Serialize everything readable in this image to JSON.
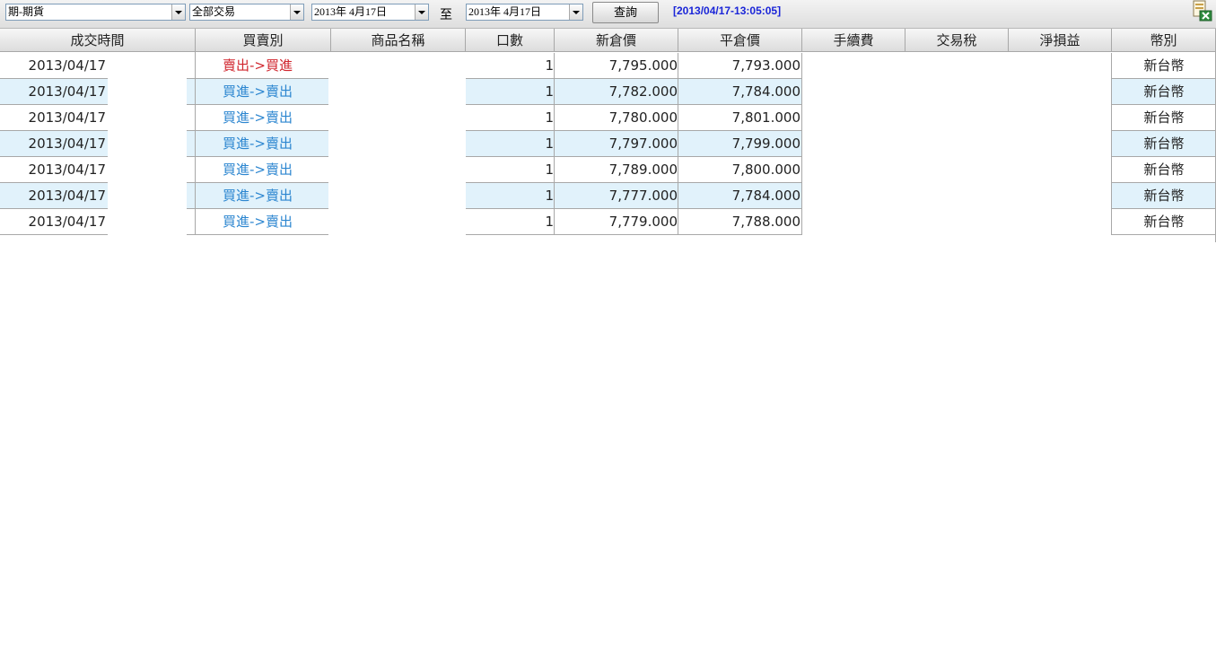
{
  "toolbar": {
    "account_select": "期-期貨",
    "trade_type_select": "全部交易",
    "date_from": "2013年  4月17日",
    "to_label": "至",
    "date_to": "2013年  4月17日",
    "query_label": "查詢",
    "timestamp": "[2013/04/17-13:05:05]"
  },
  "columns": [
    "成交時間",
    "買賣別",
    "商品名稱",
    "口數",
    "新倉價",
    "平倉價",
    "手續費",
    "交易稅",
    "淨損益",
    "幣別"
  ],
  "rows": [
    {
      "time": "2013/04/17",
      "direction": "賣出->買進",
      "product": "",
      "qty": "1",
      "open_price": "7,795.000",
      "close_price": "7,793.000",
      "fee": "",
      "tax": "",
      "pnl": "",
      "currency": "新台幣"
    },
    {
      "time": "2013/04/17",
      "direction": "買進->賣出",
      "product": "",
      "qty": "1",
      "open_price": "7,782.000",
      "close_price": "7,784.000",
      "fee": "",
      "tax": "",
      "pnl": "",
      "currency": "新台幣"
    },
    {
      "time": "2013/04/17",
      "direction": "買進->賣出",
      "product": "",
      "qty": "1",
      "open_price": "7,780.000",
      "close_price": "7,801.000",
      "fee": "",
      "tax": "",
      "pnl": "",
      "currency": "新台幣"
    },
    {
      "time": "2013/04/17",
      "direction": "買進->賣出",
      "product": "",
      "qty": "1",
      "open_price": "7,797.000",
      "close_price": "7,799.000",
      "fee": "",
      "tax": "",
      "pnl": "",
      "currency": "新台幣"
    },
    {
      "time": "2013/04/17",
      "direction": "買進->賣出",
      "product": "",
      "qty": "1",
      "open_price": "7,789.000",
      "close_price": "7,800.000",
      "fee": "",
      "tax": "",
      "pnl": "",
      "currency": "新台幣"
    },
    {
      "time": "2013/04/17",
      "direction": "買進->賣出",
      "product": "",
      "qty": "1",
      "open_price": "7,777.000",
      "close_price": "7,784.000",
      "fee": "",
      "tax": "",
      "pnl": "",
      "currency": "新台幣"
    },
    {
      "time": "2013/04/17",
      "direction": "買進->賣出",
      "product": "",
      "qty": "1",
      "open_price": "7,779.000",
      "close_price": "7,788.000",
      "fee": "",
      "tax": "",
      "pnl": "",
      "currency": "新台幣"
    }
  ],
  "colors": {
    "sell_to_buy": "#d0262e",
    "buy_to_sell": "#2c86d0",
    "alt_row": "#e1f2fb",
    "timestamp": "#1a25d8"
  },
  "icons": {
    "export": "excel-export-icon"
  }
}
